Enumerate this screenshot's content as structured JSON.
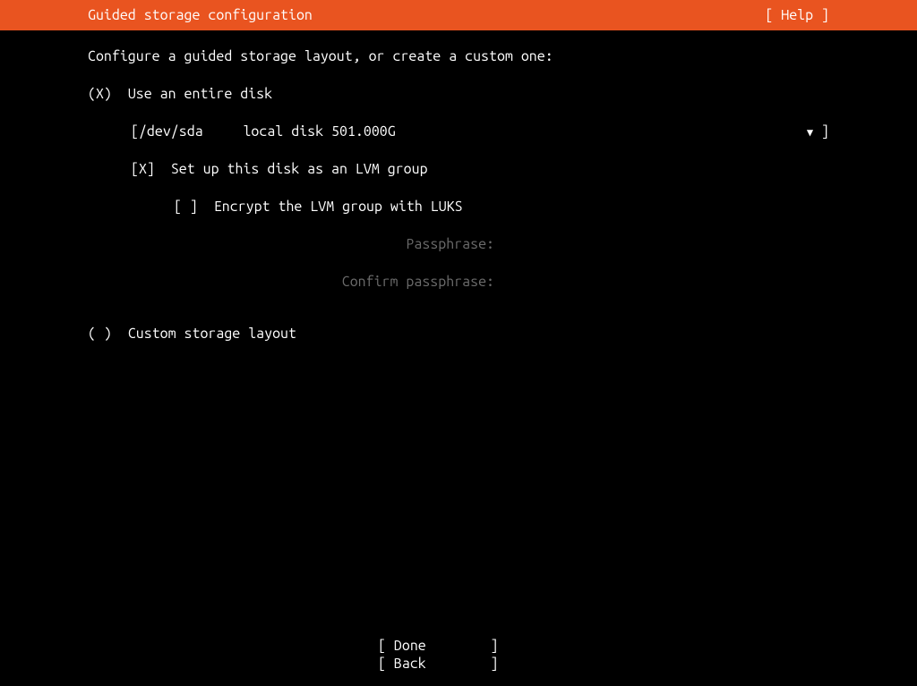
{
  "header": {
    "title": "Guided storage configuration",
    "help": "[ Help ]"
  },
  "intro": "Configure a guided storage layout, or create a custom one:",
  "options": {
    "entire_disk": {
      "radio": "(X)",
      "label": "Use an entire disk"
    },
    "disk_select": {
      "open": "[ ",
      "device": "/dev/sda",
      "desc": "local disk 501.000G",
      "close": " ]"
    },
    "lvm": {
      "checkbox": "[X]",
      "label": "Set up this disk as an LVM group"
    },
    "luks": {
      "checkbox": "[ ]",
      "label": "Encrypt the LVM group with LUKS"
    },
    "passphrase_label": "Passphrase:",
    "confirm_label": "Confirm passphrase:",
    "custom": {
      "radio": "( )",
      "label": "Custom storage layout"
    }
  },
  "footer": {
    "done": "[ Done        ]",
    "back": "[ Back        ]"
  }
}
